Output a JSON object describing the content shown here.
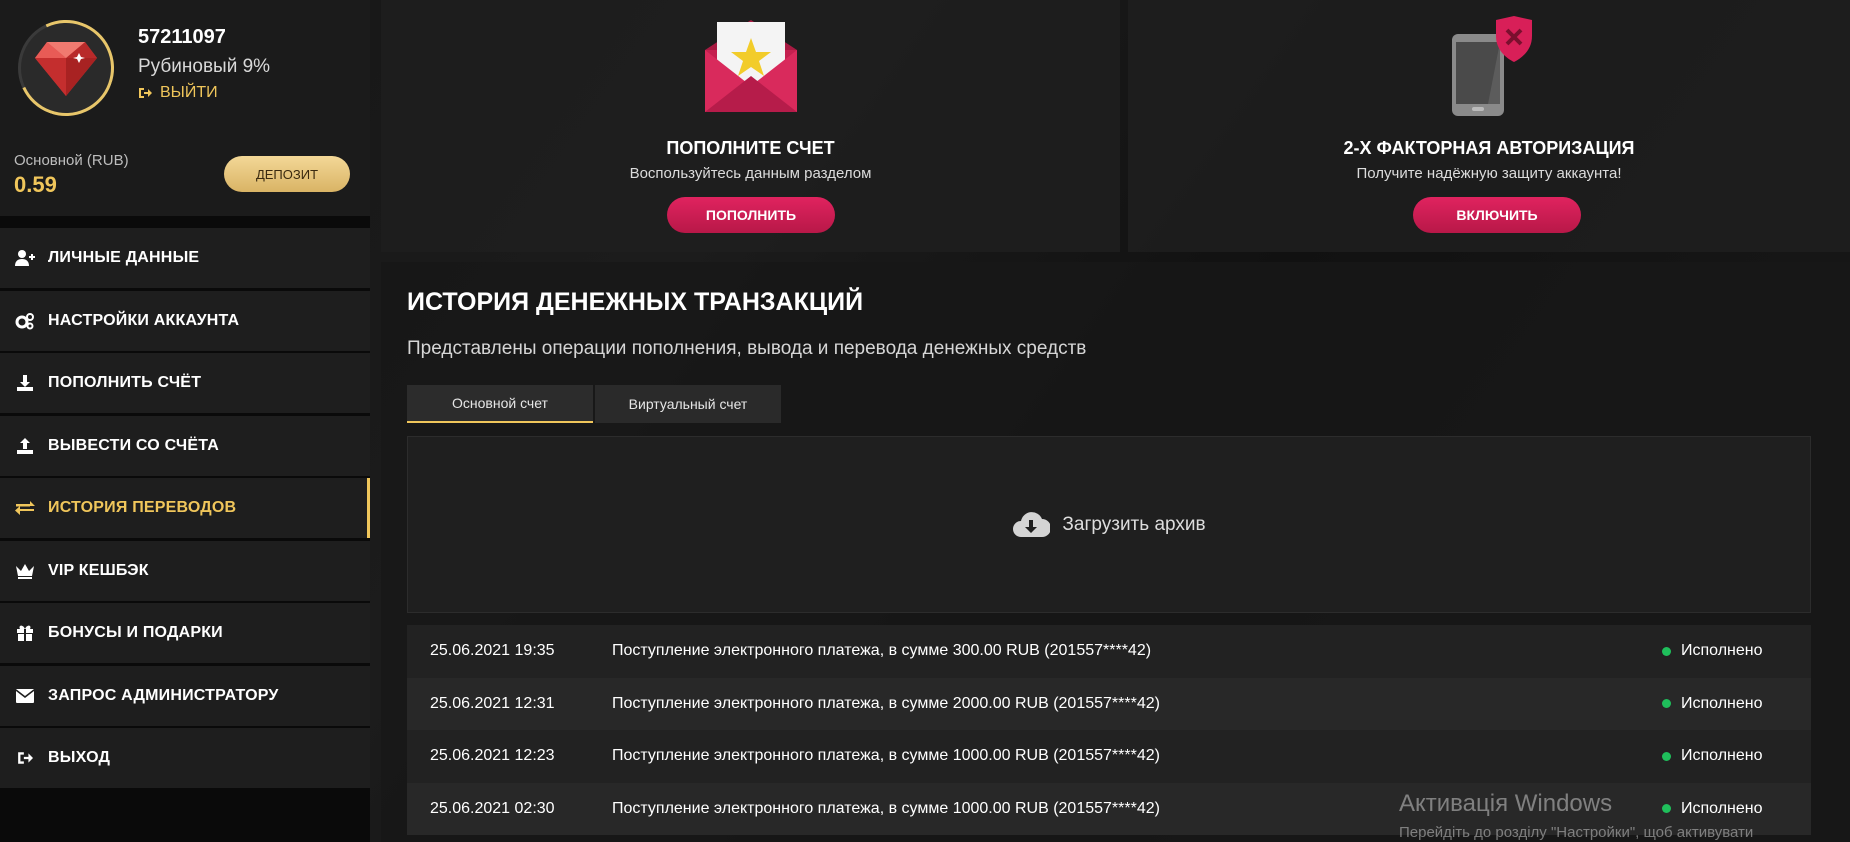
{
  "profile": {
    "user_id": "57211097",
    "level": "Рубиновый 9%",
    "logout_label": "ВЫЙТИ",
    "balance_label": "Основной (RUB)",
    "balance_value": "0.59",
    "deposit_label": "ДЕПОЗИТ",
    "avatar_icon": "ruby-gem-icon"
  },
  "menu": {
    "items": [
      {
        "label": "ЛИЧНЫЕ ДАННЫЕ",
        "icon": "user-plus-icon",
        "active": false
      },
      {
        "label": "НАСТРОЙКИ АККАУНТА",
        "icon": "gears-icon",
        "active": false
      },
      {
        "label": "ПОПОЛНИТЬ СЧЁТ",
        "icon": "download-icon",
        "active": false
      },
      {
        "label": "ВЫВЕСТИ СО СЧЁТА",
        "icon": "upload-icon",
        "active": false
      },
      {
        "label": "ИСТОРИЯ ПЕРЕВОДОВ",
        "icon": "exchange-arrows-icon",
        "active": true
      },
      {
        "label": "VIP КЕШБЭК",
        "icon": "crown-icon",
        "active": false
      },
      {
        "label": "БОНУСЫ И ПОДАРКИ",
        "icon": "gift-icon",
        "active": false
      },
      {
        "label": "ЗАПРОС АДМИНИСТРАТОРУ",
        "icon": "envelope-icon",
        "active": false
      },
      {
        "label": "ВЫХОД",
        "icon": "sign-out-icon",
        "active": false
      }
    ]
  },
  "cards": {
    "topup": {
      "title": "ПОПОЛНИТЕ СЧЕТ",
      "subtitle": "Воспользуйтесь данным разделом",
      "button": "ПОПОЛНИТЬ",
      "icon": "envelope-star-icon"
    },
    "twofa": {
      "title": "2-Х ФАКТОРНАЯ АВТОРИЗАЦИЯ",
      "subtitle": "Получите надёжную защиту аккаунта!",
      "button": "ВКЛЮЧИТЬ",
      "icon": "phone-shield-icon"
    }
  },
  "history": {
    "title": "ИСТОРИЯ ДЕНЕЖНЫХ ТРАНЗАКЦИЙ",
    "subtitle": "Представлены операции пополнения, вывода и перевода денежных средств",
    "tabs": [
      {
        "label": "Основной счет",
        "active": true
      },
      {
        "label": "Виртуальный счет",
        "active": false
      }
    ],
    "archive_label": "Загрузить архив",
    "rows": [
      {
        "date": "25.06.2021 19:35",
        "desc": "Поступление электронного платежа, в сумме 300.00 RUB (201557****42)",
        "status": "Исполнено"
      },
      {
        "date": "25.06.2021 12:31",
        "desc": "Поступление электронного платежа, в сумме 2000.00 RUB (201557****42)",
        "status": "Исполнено"
      },
      {
        "date": "25.06.2021 12:23",
        "desc": "Поступление электронного платежа, в сумме 1000.00 RUB (201557****42)",
        "status": "Исполнено"
      },
      {
        "date": "25.06.2021 02:30",
        "desc": "Поступление электронного платежа, в сумме 1000.00 RUB (201557****42)",
        "status": "Исполнено"
      }
    ]
  },
  "watermark": {
    "line1": "Активація Windows",
    "line2": "Перейдіть до розділу \"Настройки\", щоб активувати"
  },
  "colors": {
    "accent_gold": "#f0c65b",
    "accent_pink": "#d81f58",
    "status_green": "#1fbf5b"
  }
}
